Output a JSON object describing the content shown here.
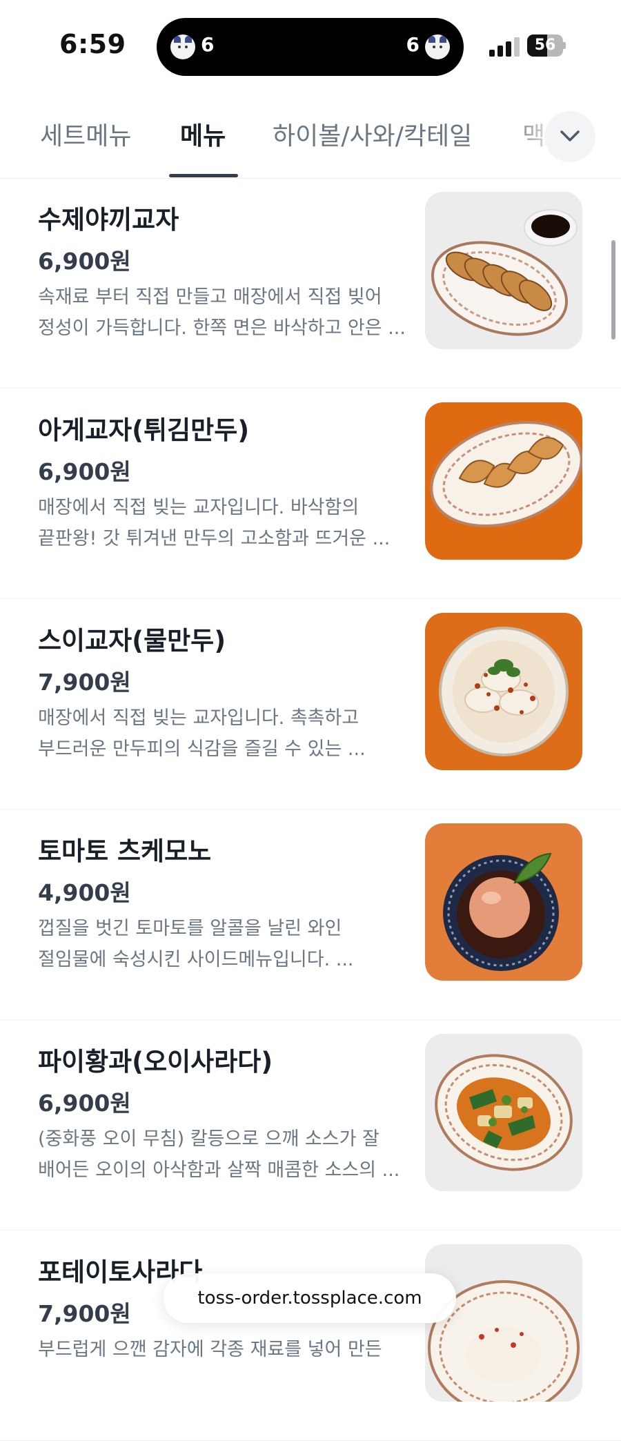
{
  "status_bar": {
    "time": "6:59",
    "island_left_count": "6",
    "island_right_count": "6",
    "battery_level": "56"
  },
  "tabs": [
    {
      "label": "세트메뉴",
      "active": false
    },
    {
      "label": "메뉴",
      "active": true
    },
    {
      "label": "하이볼/사와/칵테일",
      "active": false
    },
    {
      "label": "맥",
      "active": false
    }
  ],
  "tabs_expand_icon": "chevron-down-icon",
  "menu_items": [
    {
      "name": "수제야끼교자",
      "price": "6,900원",
      "desc_line1": "속재료 부터 직접 만들고 매장에서 직접 빚어",
      "desc_line2": "정성이 가득합니다. 한쪽 면은 바삭하고 안은 ...",
      "image": "fried-gyoza-plate-photo"
    },
    {
      "name": "아게교자(튀김만두)",
      "price": "6,900원",
      "desc_line1": "매장에서 직접 빚는 교자입니다. 바삭함의",
      "desc_line2": "끝판왕! 갓 튀겨낸 만두의 고소함과 뜨거운 ...",
      "image": "deep-fried-dumplings-photo"
    },
    {
      "name": "스이교자(물만두)",
      "price": "7,900원",
      "desc_line1": "매장에서 직접 빚는 교자입니다. 촉촉하고",
      "desc_line2": "부드러운 만두피의 식감을 즐길 수 있는 ...",
      "image": "boiled-dumplings-bowl-photo"
    },
    {
      "name": "토마토 츠케모노",
      "price": "4,900원",
      "desc_line1": "껍질을 벗긴 토마토를 알콜을 날린 와인",
      "desc_line2": "절임물에 숙성시킨 사이드메뉴입니다. ...",
      "image": "marinated-tomato-bowl-photo"
    },
    {
      "name": "파이황과(오이사라다)",
      "price": "6,900원",
      "desc_line1": "(중화풍 오이 무침) 칼등으로 으깨 소스가 잘",
      "desc_line2": "배어든 오이의 아삭함과 살짝 매콤한 소스의 ...",
      "image": "cucumber-salad-plate-photo"
    },
    {
      "name": "포테이토사라다",
      "price": "7,900원",
      "desc_line1": "부드럽게 으깬 감자에 각종 재료를 넣어 만든",
      "desc_line2": "",
      "image": "potato-salad-photo"
    }
  ],
  "url_bar": {
    "text": "toss-order.tossplace.com"
  },
  "colors": {
    "text_primary": "#191f28",
    "text_secondary": "#6b7684",
    "tab_indicator": "#333d4b",
    "divider": "#f2f3f5",
    "chip_bg": "#f2f4f6"
  }
}
